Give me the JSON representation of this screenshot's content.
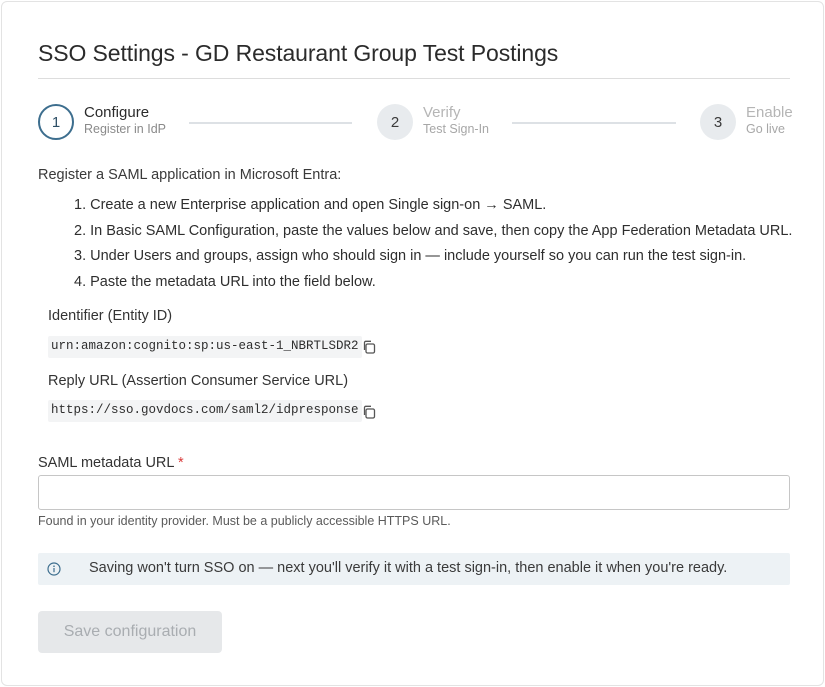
{
  "page": {
    "title": "SSO Settings - GD Restaurant Group Test Postings"
  },
  "stepper": {
    "steps": [
      {
        "number": "1",
        "title": "Configure",
        "subtitle": "Register in IdP",
        "state": "active"
      },
      {
        "number": "2",
        "title": "Verify",
        "subtitle": "Test Sign-In",
        "state": "inactive"
      },
      {
        "number": "3",
        "title": "Enable",
        "subtitle": "Go live",
        "state": "inactive"
      }
    ]
  },
  "instructions": {
    "intro": "Register a SAML application in Microsoft Entra:",
    "items": [
      "1. Create a new Enterprise application and open Single sign-on → SAML.",
      "2. In Basic SAML Configuration, paste the values below and save, then copy the App Federation Metadata URL.",
      "3. Under Users and groups, assign who should sign in — include yourself so you can run the test sign-in.",
      "4. Paste the metadata URL into the field below."
    ]
  },
  "entity_id": {
    "label": "Identifier (Entity ID)",
    "value": "urn:amazon:cognito:sp:us-east-1_NBRTLSDR2",
    "copy_icon": "copy-icon"
  },
  "reply_url": {
    "label": "Reply URL (Assertion Consumer Service URL)",
    "value": "https://sso.govdocs.com/saml2/idpresponse",
    "copy_icon": "copy-icon"
  },
  "metadata_input": {
    "label": "SAML metadata URL",
    "required_mark": "*",
    "value": "",
    "placeholder": "",
    "hint": "Found in your identity provider. Must be a publicly accessible HTTPS URL."
  },
  "info": {
    "icon": "info-icon",
    "text": "Saving won't turn SSO on — next you'll verify it with a test sign-in, then enable it when you're ready."
  },
  "actions": {
    "save_label": "Save configuration",
    "save_disabled": true
  },
  "colors": {
    "accent": "#3d6e8e",
    "required": "#d93a3a",
    "info_background": "#edf2f5",
    "disabled_button": "#e6e8ea"
  }
}
